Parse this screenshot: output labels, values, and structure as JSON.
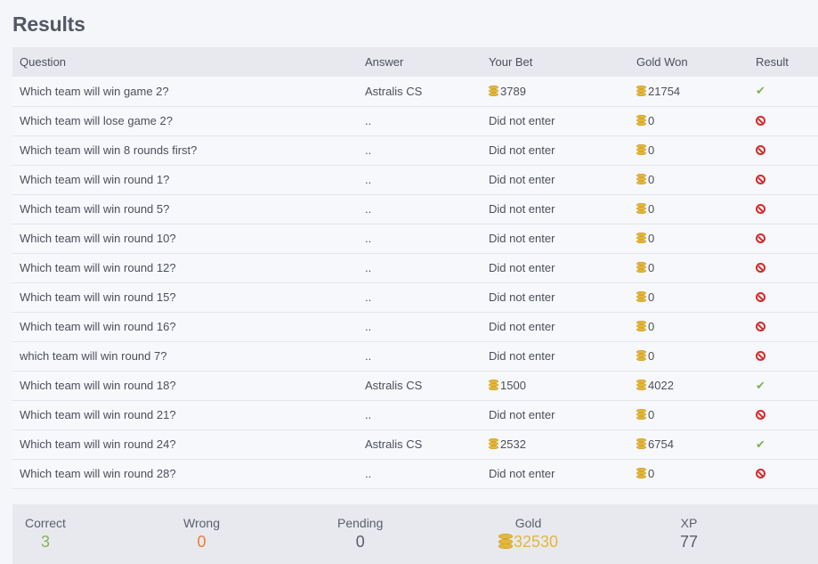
{
  "page": {
    "title": "Results"
  },
  "table": {
    "headers": {
      "question": "Question",
      "answer": "Answer",
      "bet": "Your Bet",
      "gold": "Gold Won",
      "result": "Result"
    },
    "rows": [
      {
        "question": "Which team will win game 2?",
        "answer": "Astralis CS",
        "bet": "3789",
        "bet_coin": true,
        "gold": "21754",
        "result": "correct"
      },
      {
        "question": "Which team will lose game 2?",
        "answer": "..",
        "bet": "Did not enter",
        "bet_coin": false,
        "gold": "0",
        "result": "wrong"
      },
      {
        "question": "Which team will win 8 rounds first?",
        "answer": "..",
        "bet": "Did not enter",
        "bet_coin": false,
        "gold": "0",
        "result": "wrong"
      },
      {
        "question": "Which team will win round 1?",
        "answer": "..",
        "bet": "Did not enter",
        "bet_coin": false,
        "gold": "0",
        "result": "wrong"
      },
      {
        "question": "Which team will win round 5?",
        "answer": "..",
        "bet": "Did not enter",
        "bet_coin": false,
        "gold": "0",
        "result": "wrong"
      },
      {
        "question": "Which team will win round 10?",
        "answer": "..",
        "bet": "Did not enter",
        "bet_coin": false,
        "gold": "0",
        "result": "wrong"
      },
      {
        "question": "Which team will win round 12?",
        "answer": "..",
        "bet": "Did not enter",
        "bet_coin": false,
        "gold": "0",
        "result": "wrong"
      },
      {
        "question": "Which team will win round 15?",
        "answer": "..",
        "bet": "Did not enter",
        "bet_coin": false,
        "gold": "0",
        "result": "wrong"
      },
      {
        "question": "Which team will win round 16?",
        "answer": "..",
        "bet": "Did not enter",
        "bet_coin": false,
        "gold": "0",
        "result": "wrong"
      },
      {
        "question": "which team will win round 7?",
        "answer": "..",
        "bet": "Did not enter",
        "bet_coin": false,
        "gold": "0",
        "result": "wrong"
      },
      {
        "question": "Which team will win round 18?",
        "answer": "Astralis CS",
        "bet": "1500",
        "bet_coin": true,
        "gold": "4022",
        "result": "correct"
      },
      {
        "question": "Which team will win round 21?",
        "answer": "..",
        "bet": "Did not enter",
        "bet_coin": false,
        "gold": "0",
        "result": "wrong"
      },
      {
        "question": "Which team will win round 24?",
        "answer": "Astralis CS",
        "bet": "2532",
        "bet_coin": true,
        "gold": "6754",
        "result": "correct"
      },
      {
        "question": "Which team will win round 28?",
        "answer": "..",
        "bet": "Did not enter",
        "bet_coin": false,
        "gold": "0",
        "result": "wrong"
      }
    ]
  },
  "summary": {
    "correct": {
      "label": "Correct",
      "value": "3"
    },
    "wrong": {
      "label": "Wrong",
      "value": "0"
    },
    "pending": {
      "label": "Pending",
      "value": "0"
    },
    "gold": {
      "label": "Gold",
      "value": "32530"
    },
    "xp": {
      "label": "XP",
      "value": "77"
    }
  },
  "colors": {
    "correct": "#8ab05c",
    "wrong": "#ef7a3a",
    "gold": "#e3b73c",
    "fail_icon": "#d42a2a",
    "check_icon": "#7fb25a"
  },
  "icons": {
    "coin": "coin-stack-icon",
    "correct": "check-icon",
    "wrong": "ban-icon"
  }
}
